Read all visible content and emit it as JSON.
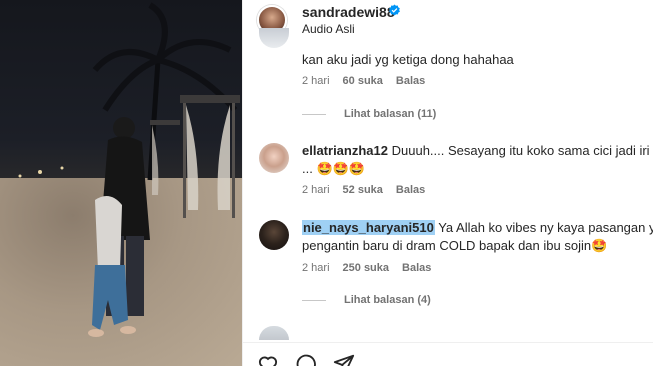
{
  "post": {
    "username": "sandradewi88",
    "audio": "Audio Asli"
  },
  "comments": [
    {
      "text": "kan aku jadi yg ketiga dong hahahaa",
      "time": "2 hari",
      "likes": "60 suka",
      "reply": "Balas",
      "view_replies": "Lihat balasan (11)"
    },
    {
      "user": "ellatrianzha12",
      "text": " Duuuh.... Sesayang itu koko sama cici jadi iri de",
      "line2": "... 🤩🤩🤩",
      "time": "2 hari",
      "likes": "52 suka",
      "reply": "Balas"
    },
    {
      "user": "nie_nays_haryani510",
      "text": " Ya Allah ko vibes ny kaya pasangan yg",
      "line2": "pengantin baru di dram COLD bapak dan ibu sojin🤩",
      "time": "2 hari",
      "likes": "250 suka",
      "reply": "Balas",
      "view_replies": "Lihat balasan (4)"
    }
  ],
  "colors": {
    "verified": "#0095f6",
    "highlight": "#9fd0f4",
    "meta": "#737373"
  },
  "icons": [
    "verified-badge-icon",
    "heart-icon",
    "comment-icon",
    "share-icon"
  ]
}
